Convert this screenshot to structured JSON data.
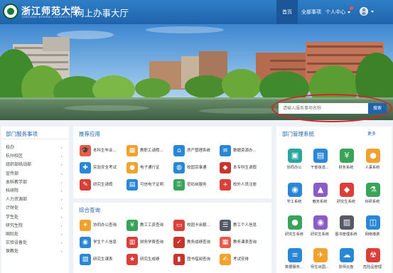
{
  "header": {
    "university_name": "浙江师范大学",
    "university_name_en": "ZHEJIANG NORMAL UNIVERSITY",
    "portal_title": "网上办事大厅",
    "nav": {
      "home": "首页",
      "all_services": "全部事项",
      "personal_center": "个人中心"
    }
  },
  "search": {
    "placeholder": "请输入服务事项名称",
    "button_label": "搜索"
  },
  "dept_services": {
    "title": "部门服务事项",
    "items": [
      "校办",
      "杭州校区",
      "组织部统战部",
      "宣传部",
      "本科教学部",
      "科研院",
      "人力资源部",
      "计财处",
      "学生处",
      "研究生院",
      "国际处",
      "实验设备处",
      "保教处"
    ]
  },
  "recommended": {
    "title": "推荐应用",
    "apps": [
      {
        "label": "本科生毕业...",
        "icon": "graduation-icon",
        "color": "#e85b4a"
      },
      {
        "label": "教职工请假...",
        "icon": "calendar-icon",
        "color": "#f0a12e"
      },
      {
        "label": "房产管理系统",
        "icon": "house-icon",
        "color": "#2a86d6"
      },
      {
        "label": "数据资源办...",
        "icon": "database-icon",
        "color": "#2a86d6"
      },
      {
        "label": "实验安全考试",
        "icon": "shield-icon",
        "color": "#2a86d6"
      },
      {
        "label": "电子通行证",
        "icon": "person-icon",
        "color": "#f0a12e"
      },
      {
        "label": "校园百事通",
        "icon": "globe-icon",
        "color": "#2a86d6"
      },
      {
        "label": "本专科生请假",
        "icon": "person-group-icon",
        "color": "#c8342e"
      },
      {
        "label": "研究生请假",
        "icon": "note-icon",
        "color": "#d9403a"
      },
      {
        "label": "可信电子证明",
        "icon": "printer-icon",
        "color": "#2a86d6"
      },
      {
        "label": "密码自服务",
        "icon": "key-icon",
        "color": "#3aa35a"
      },
      {
        "label": "校外人员注册",
        "icon": "user-add-icon",
        "color": "#d9403a"
      }
    ]
  },
  "comprehensive": {
    "title": "综合查询",
    "apps": [
      {
        "label": "协同办公查询",
        "icon": "handshake-icon",
        "color": "#f0a12e"
      },
      {
        "label": "教工工资查询",
        "icon": "salary-icon",
        "color": "#3aa35a"
      },
      {
        "label": "校园卡余额...",
        "icon": "card-icon",
        "color": "#d9403a"
      },
      {
        "label": "教工个人信息",
        "icon": "profile-icon",
        "color": "#555a63"
      },
      {
        "label": "学生个人信息",
        "icon": "student-icon",
        "color": "#2a86d6"
      },
      {
        "label": "财务学费查询",
        "icon": "receipt-icon",
        "color": "#d9403a"
      },
      {
        "label": "教务成绩查询",
        "icon": "score-icon",
        "color": "#c8342e"
      },
      {
        "label": "教务课表查询",
        "icon": "timetable-icon",
        "color": "#e85b4a"
      },
      {
        "label": "研究生课表",
        "icon": "course-icon",
        "color": "#2a86d6"
      },
      {
        "label": "研究生成绩",
        "icon": "grade-icon",
        "color": "#d9403a"
      },
      {
        "label": "图书借阅查询",
        "icon": "book-icon",
        "color": "#c8342e"
      },
      {
        "label": "考试安排",
        "icon": "exam-icon",
        "color": "#f0a12e"
      }
    ]
  },
  "dept_systems": {
    "title": "部门管理系统",
    "more": "更多",
    "tiles": [
      {
        "label": "协同办公",
        "icon": "monitor-icon",
        "color": "#2aa6a0"
      },
      {
        "label": "干部信息...",
        "icon": "id-card-icon",
        "color": "#2a86d6"
      },
      {
        "label": "财务系统",
        "icon": "yuan-icon",
        "color": "#3aa35a"
      },
      {
        "label": "人事系统",
        "icon": "person-icon",
        "color": "#f0a12e"
      },
      {
        "label": "学工系统",
        "icon": "students-icon",
        "color": "#2a86d6"
      },
      {
        "label": "教务系统",
        "icon": "teaching-icon",
        "color": "#8a5cc7"
      },
      {
        "label": "研究生系统",
        "icon": "cap-icon",
        "color": "#d9403a"
      },
      {
        "label": "科研系统",
        "icon": "flask-icon",
        "color": "#3aa35a"
      },
      {
        "label": "研究生系统",
        "icon": "teacher-icon",
        "color": "#3aa35a"
      },
      {
        "label": "研究生系统",
        "icon": "grad-person-icon",
        "color": "#8a5cc7"
      },
      {
        "label": "图书管理系统",
        "icon": "library-icon",
        "color": "#555a63"
      },
      {
        "label": "网络缴费",
        "icon": "network-icon",
        "color": "#2a86d6"
      },
      {
        "label": "数据服务...",
        "icon": "database-icon",
        "color": "#2a86d6"
      },
      {
        "label": "师生出国...",
        "icon": "plane-icon",
        "color": "#f0a12e"
      },
      {
        "label": "浙师云盘",
        "icon": "cloud-icon",
        "color": "#2a86d6"
      },
      {
        "label": "危险品管理",
        "icon": "hazard-icon",
        "color": "#d9403a"
      }
    ]
  }
}
